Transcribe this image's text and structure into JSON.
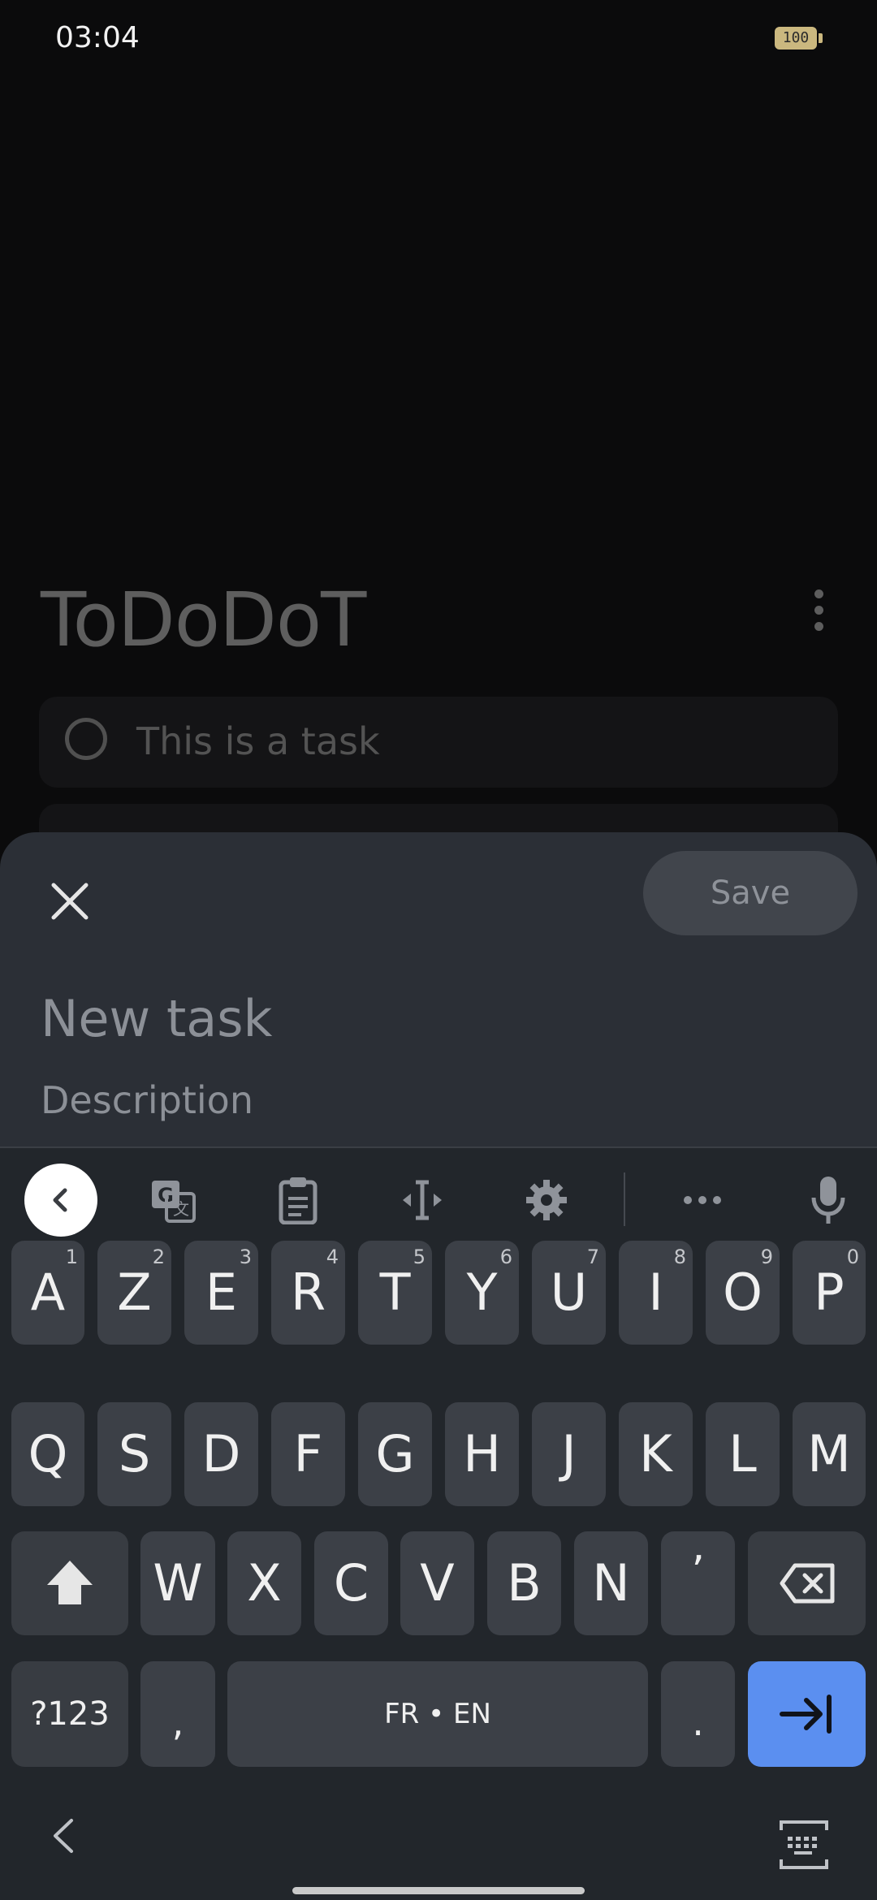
{
  "status_bar": {
    "time": "03:04",
    "battery": "100"
  },
  "app": {
    "title": "ToDoDoT",
    "tasks": [
      {
        "label": "This is a task"
      }
    ]
  },
  "sheet": {
    "save_label": "Save",
    "task_placeholder": "New task",
    "description_placeholder": "Description"
  },
  "keyboard": {
    "toolbar": [
      "back-icon",
      "translate-icon",
      "clipboard-icon",
      "cursor-move-icon",
      "settings-icon",
      "more-icon",
      "microphone-icon"
    ],
    "rows": [
      [
        {
          "k": "A",
          "n": "1"
        },
        {
          "k": "Z",
          "n": "2"
        },
        {
          "k": "E",
          "n": "3"
        },
        {
          "k": "R",
          "n": "4"
        },
        {
          "k": "T",
          "n": "5"
        },
        {
          "k": "Y",
          "n": "6"
        },
        {
          "k": "U",
          "n": "7"
        },
        {
          "k": "I",
          "n": "8"
        },
        {
          "k": "O",
          "n": "9"
        },
        {
          "k": "P",
          "n": "0"
        }
      ],
      [
        {
          "k": "Q"
        },
        {
          "k": "S"
        },
        {
          "k": "D"
        },
        {
          "k": "F"
        },
        {
          "k": "G"
        },
        {
          "k": "H"
        },
        {
          "k": "J"
        },
        {
          "k": "K"
        },
        {
          "k": "L"
        },
        {
          "k": "M"
        }
      ],
      [
        {
          "k": "W"
        },
        {
          "k": "X"
        },
        {
          "k": "C"
        },
        {
          "k": "V"
        },
        {
          "k": "B"
        },
        {
          "k": "N"
        },
        {
          "k": "’"
        }
      ]
    ],
    "symbols_label": "?123",
    "comma": ",",
    "space_label": "FR • EN",
    "period": "."
  },
  "colors": {
    "sheet_bg": "#2b2f36",
    "key_bg": "#3c4047",
    "accent": "#5b8ff0"
  }
}
